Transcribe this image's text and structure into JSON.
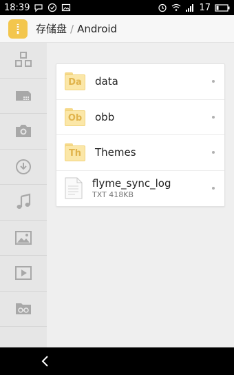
{
  "status_bar": {
    "time": "18:39",
    "battery_level": "17"
  },
  "app_bar": {
    "root": "存储盘",
    "separator": "/",
    "current": "Android"
  },
  "sidebar": {
    "items": [
      {
        "icon": "category-icon"
      },
      {
        "icon": "sd-card-icon"
      },
      {
        "icon": "camera-icon"
      },
      {
        "icon": "download-icon"
      },
      {
        "icon": "music-icon"
      },
      {
        "icon": "image-icon"
      },
      {
        "icon": "video-icon"
      },
      {
        "icon": "private-folder-icon"
      }
    ]
  },
  "files": [
    {
      "name": "data",
      "type": "folder",
      "badge": "Da"
    },
    {
      "name": "obb",
      "type": "folder",
      "badge": "Ob"
    },
    {
      "name": "Themes",
      "type": "folder",
      "badge": "Th"
    },
    {
      "name": "flyme_sync_log",
      "type": "file",
      "info": "TXT 418KB"
    }
  ],
  "colors": {
    "accent": "#f3c64d",
    "folder": "#fbe7a8",
    "folder_text": "#e0b34b"
  }
}
